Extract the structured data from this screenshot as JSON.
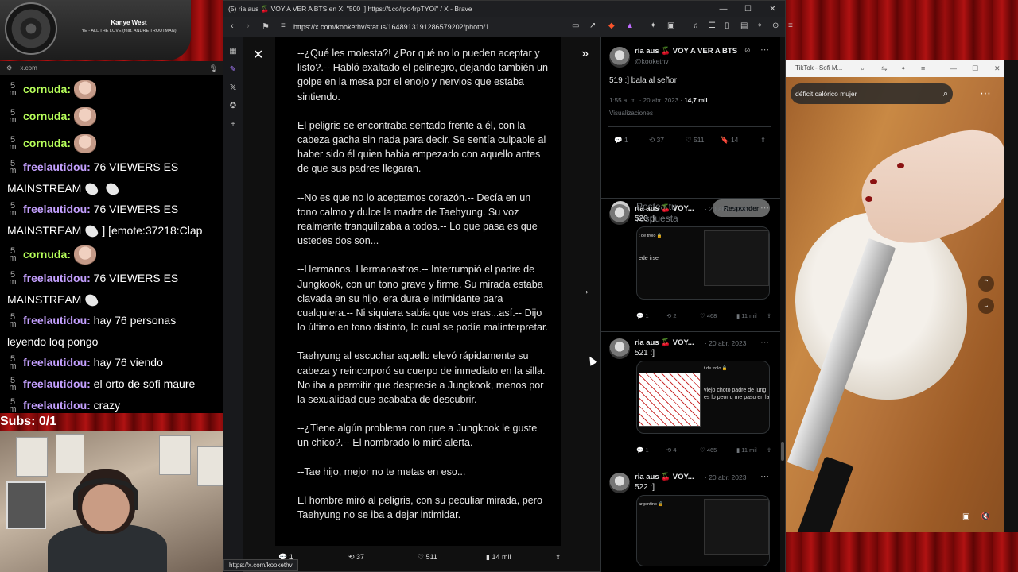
{
  "now_playing": {
    "artist": "Kanye West",
    "song": "YE - ALL THE LOVE (feat. ANDRE TROUTMAN)"
  },
  "chat_bar": {
    "url": "x.com",
    "close_icon": "close-icon",
    "mic_icon": "mic-icon"
  },
  "chat": {
    "messages": [
      {
        "ts": "5 m",
        "user": "cornuda:",
        "text": "",
        "emote": true
      },
      {
        "ts": "5 m",
        "user": "cornuda:",
        "text": "",
        "emote": true
      },
      {
        "ts": "5 m",
        "user": "cornuda:",
        "text": "",
        "emote": true
      },
      {
        "ts": "5 m",
        "user": "freelautidou:",
        "text": "76 VIEWERS ES"
      },
      {
        "ts": "",
        "user": "",
        "text": "MAINSTREAM"
      },
      {
        "ts": "5 m",
        "user": "freelautidou:",
        "text": "76 VIEWERS ES"
      },
      {
        "ts": "",
        "user": "",
        "text": "MAINSTREAM",
        "tail": "] [emote:37218:Clap"
      },
      {
        "ts": "5 m",
        "user": "cornuda:",
        "text": "",
        "emote": true
      },
      {
        "ts": "5 m",
        "user": "freelautidou:",
        "text": "76 VIEWERS ES"
      },
      {
        "ts": "",
        "user": "",
        "text": "MAINSTREAM"
      },
      {
        "ts": "5 m",
        "user": "freelautidou:",
        "text": "hay 76 personas"
      },
      {
        "ts": "",
        "user": "",
        "text": "leyendo loq pongo"
      },
      {
        "ts": "5 m",
        "user": "freelautidou:",
        "text": "hay 76 viendo"
      },
      {
        "ts": "5 m",
        "user": "freelautidou:",
        "text": "el orto de sofi maure"
      },
      {
        "ts": "5 m",
        "user": "freelautidou:",
        "text": "crazy"
      }
    ]
  },
  "subs": "Subs: 0/1",
  "browser": {
    "title": "(5) ria aus 🍒 VOY A VER A BTS en X: \"500 :] https://t.co/rpo4rpTYOi\" / X - Brave",
    "url": "https://x.com/kookethv/status/1648913191286579202/photo/1",
    "status_url": "https://x.com/kookethv"
  },
  "story": {
    "paragraphs": [
      "--¿Qué les molesta?! ¿Por qué no lo pueden aceptar y listo?.-- Habló exaltado el pelinegro, dejando también un golpe en la mesa por el enojo y nervios que estaba sintiendo.",
      "El peligris se encontraba sentado frente a él, con la cabeza gacha sin nada para decir. Se sentía culpable al haber sido él quien habia empezado con aquello antes de que sus padres llegaran.",
      "--No es que no lo aceptamos corazón.-- Decía en un tono calmo y dulce la madre de Taehyung. Su voz realmente tranquilizaba a todos.-- Lo que pasa es que ustedes dos son...",
      "--Hermanos. Hermanastros.-- Interrumpió el padre de Jungkook, con un tono grave y firme. Su mirada estaba clavada en su hijo, era dura e intimidante para cualquiera.-- Ni siquiera sabía que vos eras...así.-- Dijo lo último en tono distinto, lo cual se podía malinterpretar.",
      "Taehyung al escuchar aquello elevó rápidamente su cabeza y reincorporó su cuerpo de inmediato en la silla. No iba a permitir que desprecie a Jungkook, menos por la sexualidad que acababa de descubrir.",
      "--¿Tiene algún problema con que a Jungkook le guste un chico?.-- El nombrado lo miró alerta.",
      "--Tae hijo, mejor no te metas en eso...",
      "El hombre miró al peligris, con su peculiar mirada, pero Taehyung no se iba a dejar intimidar."
    ]
  },
  "lightbox_actions": {
    "replies": "1",
    "reposts": "37",
    "likes": "511",
    "views": "14 mil"
  },
  "tweet": {
    "name": "ria aus 🍒 VOY A VER A BTS",
    "handle": "@kookethv",
    "text": "519 :]     bala al señor",
    "time": "1:55 a. m. · 20 abr. 2023 ·",
    "views_count": "14,7 mil",
    "views_label": "Visualizaciones",
    "replies": "1",
    "reposts": "37",
    "likes": "511",
    "bookmarks": "14",
    "reply_placeholder": "Postea tu respuesta",
    "reply_button": "Responder"
  },
  "replies": [
    {
      "name": "ria aus 🍒 VOY...",
      "handle": "@",
      "date": "· 20 abr. 2023",
      "text": "520 :]",
      "mini_a": "t de trolo 🔒",
      "mini_b": "ede irse",
      "replies": "1",
      "reposts": "2",
      "likes": "468",
      "views": "11 mil"
    },
    {
      "name": "ria aus 🍒 VOY...",
      "handle": "@",
      "date": "· 20 abr. 2023",
      "text": "521 :]",
      "mini_a": "t de trolo 🔒",
      "mini_b": "viejo choto padre de jung es lo peor q me paso en la",
      "replies": "1",
      "reposts": "4",
      "likes": "465",
      "views": "11 mil"
    },
    {
      "name": "ria aus 🍒 VOY...",
      "handle": "@",
      "date": "· 20 abr. 2023",
      "text": "522 :]",
      "mini_a": "argentino 🔒",
      "mini_b": "mira si t voy a seguir da",
      "replies": "",
      "reposts": "",
      "likes": "",
      "views": ""
    }
  ],
  "tiktok": {
    "title": "TikTok - Sofi M...",
    "search": "déficit calórico mujer"
  }
}
